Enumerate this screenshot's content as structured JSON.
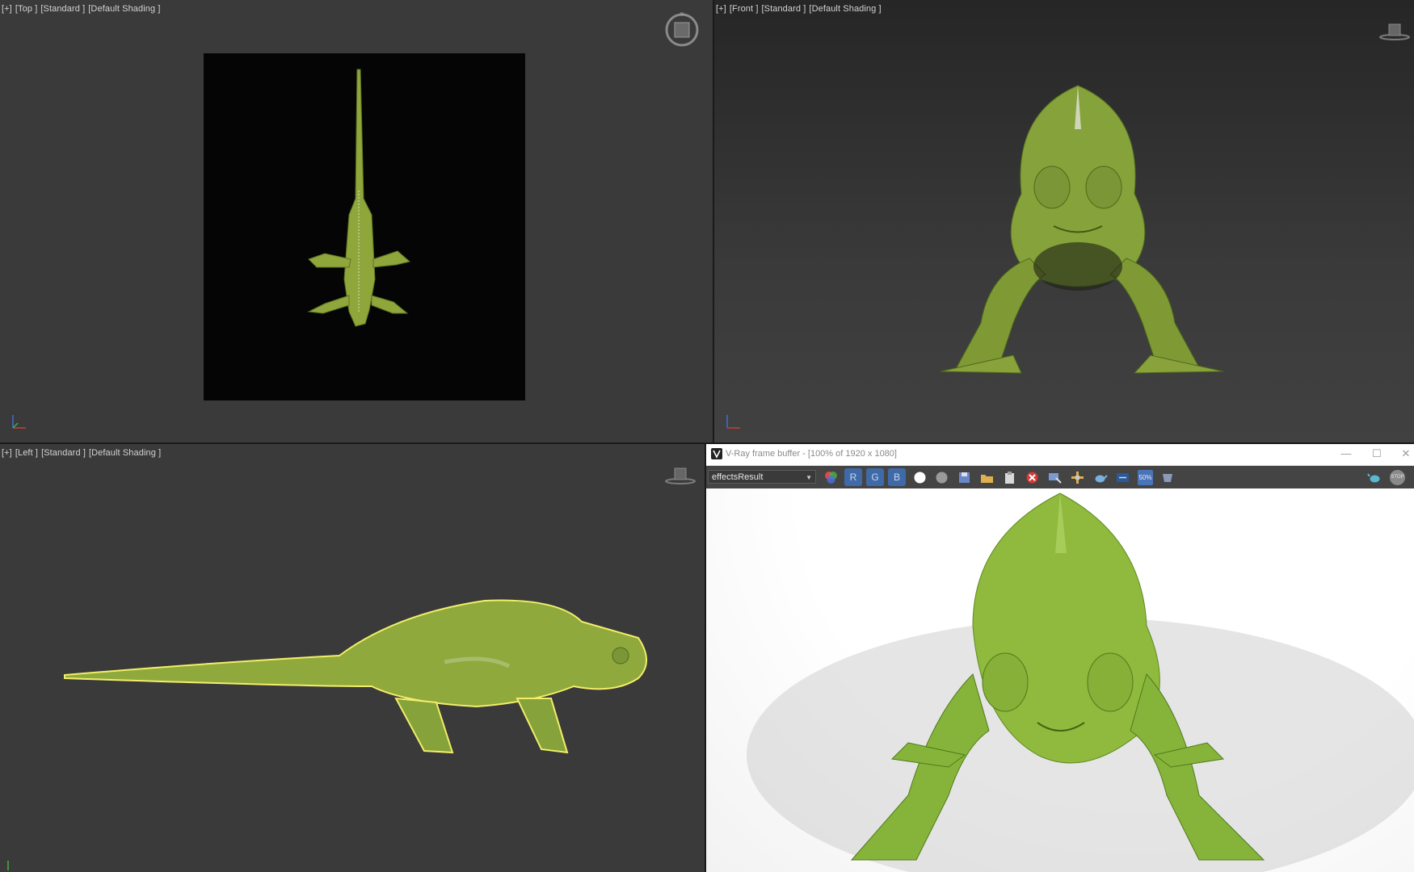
{
  "viewports": {
    "top": {
      "parts": [
        "[+]",
        "[Top ]",
        "[Standard ]",
        "[Default Shading ]"
      ]
    },
    "front": {
      "parts": [
        "[+]",
        "[Front ]",
        "[Standard ]",
        "[Default Shading ]"
      ]
    },
    "left": {
      "parts": [
        "[+]",
        "[Left ]",
        "[Standard ]",
        "[Default Shading ]"
      ]
    }
  },
  "vfb": {
    "title": "V-Ray frame buffer - [100% of 1920 x 1080]",
    "channel_select": "effectsResult",
    "channels": [
      "R",
      "G",
      "B"
    ],
    "toolbar_icons": [
      "color-corrections-icon",
      "white-circle-icon",
      "gray-circle-icon",
      "save-icon",
      "open-folder-icon",
      "clipboard-icon",
      "clear-icon",
      "track-mouse-icon",
      "region-render-icon",
      "teapot-render-icon",
      "lens-effects-icon",
      "fifty-percent-icon",
      "history-icon",
      "render-teapot-icon",
      "stop-render-icon"
    ],
    "fifty_label": "50%",
    "stop_label": "STOP"
  },
  "colors": {
    "chameleon": "#8fad3a",
    "chameleon_dark": "#6c8a2a",
    "selection_outline": "#f2ee6a",
    "vfb_accent": "#3f6aa8"
  }
}
